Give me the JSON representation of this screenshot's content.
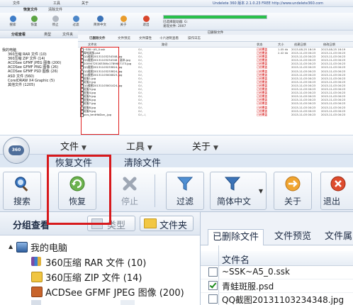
{
  "mini": {
    "menu": [
      "文件",
      "工具",
      "关于"
    ],
    "app_title": "Undelete 360 版本 2.1.0.23  FREE  http://www.undelete360.com",
    "tabs": [
      "恢复文件",
      "清除文件"
    ],
    "buttons": [
      "搜索",
      "恢复",
      "停止",
      "过滤",
      "简体中文",
      "关于",
      "退出"
    ],
    "status_files": "已选择驱动器: G:",
    "status_found": "发现文件: 2007",
    "left_header": [
      "分组查看",
      "类型",
      "文件夹"
    ],
    "tree": [
      "我的电脑",
      "360压缩 RAR 文件 (10)",
      "360压缩 ZIP 文件 (14)",
      "ACDSee GFMF JPEG 图像 (200)",
      "ACDSee GFMF PNG 图像 (26)",
      "ACDSee GFMF PSD 图像 (26)",
      "ASD 文件 (560)",
      "CorelDRAW X4 Graphic (5)",
      "其他文件 (1205)"
    ],
    "right_title": "已删除文件",
    "subtabs": [
      "已删除文件",
      "文件预览",
      "文件属性",
      "十六进制查看",
      "操作日志"
    ],
    "columns": [
      "文件名",
      "路径",
      "状态",
      "大小",
      "创建日期",
      "修改日期"
    ],
    "rows": [
      [
        "~SSK~A5_0.ssk",
        "G:\\",
        "已经覆盖",
        "1.05 kb",
        "2013-08-25 16:19",
        "2013-08-25 16:19"
      ],
      [
        "青蛙斑服.psd",
        "G:\\",
        "已经覆盖",
        "2.42 kb",
        "2013-11-03 00:23",
        "2013-11-03 00:23"
      ],
      [
        "QQ截图20131103234348.jpg",
        "G:\\",
        "已经覆盖",
        "",
        "2013-11-03 00:23",
        "2013-11-03 00:23"
      ],
      [
        "QQ截图20131103234348 - 副本.jpg",
        "G:\\",
        "已经覆盖",
        "",
        "2013-11-03 00:23",
        "2013-11-03 00:23"
      ],
      [
        "20090725163306c1789687173.jpg",
        "G:\\",
        "已经覆盖",
        "",
        "2013-11-03 00:23",
        "2013-11-03 00:23"
      ],
      [
        "QQ截图20131103233824.jpg",
        "G:\\",
        "已经覆盖",
        "",
        "2013-11-03 00:23",
        "2013-11-03 00:23"
      ],
      [
        "QQ截图20131103233824.jpg",
        "G:\\",
        "已经覆盖",
        "",
        "2013-11-03 00:23",
        "2013-11-03 00:23"
      ],
      [
        "QQ截图20131103000823.jpg",
        "G:\\",
        "已经覆盖",
        "",
        "2013-11-03 00:23",
        "2013-11-03 00:23"
      ],
      [
        "斑服1.jpg",
        "G:\\",
        "已经覆盖",
        "",
        "2013-11-03 00:23",
        "2013-11-03 00:23"
      ],
      [
        "斑服2.jpg",
        "G:\\",
        "已经覆盖",
        "",
        "2013-11-03 00:23",
        "2013-11-03 00:23"
      ],
      [
        "QQ截图20131103001424.jpg",
        "G:\\",
        "已经覆盖",
        "",
        "2013-11-03 00:23",
        "2013-11-03 00:23"
      ],
      [
        "斑服3.jpg",
        "G:\\",
        "已经覆盖",
        "",
        "2013-11-03 00:23",
        "2013-11-03 00:23"
      ],
      [
        "斑服4.jpg",
        "G:\\",
        "已经覆盖",
        "",
        "2013-11-03 00:23",
        "2013-11-03 00:23"
      ],
      [
        "斑服5.jpg",
        "G:\\",
        "已经覆盖",
        "",
        "2013-11-03 00:23",
        "2013-11-03 00:23"
      ],
      [
        "斑服6.jpg",
        "G:\\",
        "已经覆盖",
        "",
        "2013-11-03 00:23",
        "2013-11-03 00:23"
      ],
      [
        "斑服7.jpg",
        "G:\\",
        "已经覆盖",
        "",
        "2013-11-03 00:23",
        "2013-11-03 00:23"
      ],
      [
        "斑服8.jpg",
        "G:\\",
        "已经覆盖",
        "",
        "2013-11-03 00:23",
        "2013-11-03 00:23"
      ],
      [
        "斑服9.jpg",
        "G:\\",
        "已经覆盖",
        "",
        "2013-11-03 00:23",
        "2013-11-03 00:23"
      ],
      [
        "pics_tentHbDon_.jpg",
        "G:\\...\\",
        "已经覆盖",
        "",
        "2013-11-03 00:23",
        "2013-11-03 00:23"
      ]
    ]
  },
  "big": {
    "logo_text": "360",
    "menu": [
      "文件",
      "工具",
      "关于"
    ],
    "tabs": [
      "恢复文件",
      "清除文件"
    ],
    "buttons": {
      "search": "搜索",
      "recover": "恢复",
      "stop": "停止",
      "filter": "过滤",
      "language": "简体中文",
      "about": "关于",
      "exit": "退出"
    },
    "left": {
      "title": "分组查看",
      "type_btn": "类型",
      "folder_btn": "文件夹"
    },
    "tree": [
      "我的电脑",
      "360压缩 RAR 文件 (10)",
      "360压缩 ZIP 文件 (14)",
      "ACDSee GFMF JPEG 图像 (200)"
    ],
    "right": {
      "tabs": [
        "已删除文件",
        "文件预览",
        "文件属"
      ],
      "column": "文件名",
      "rows": [
        "~SSK~A5_0.ssk",
        "青蛙斑服.psd",
        "QQ截图20131103234348.jpg"
      ]
    }
  },
  "colors": {
    "accent_red": "#d7191c",
    "progress_green": "#29c04a",
    "panel_blue": "#dde7f3"
  }
}
